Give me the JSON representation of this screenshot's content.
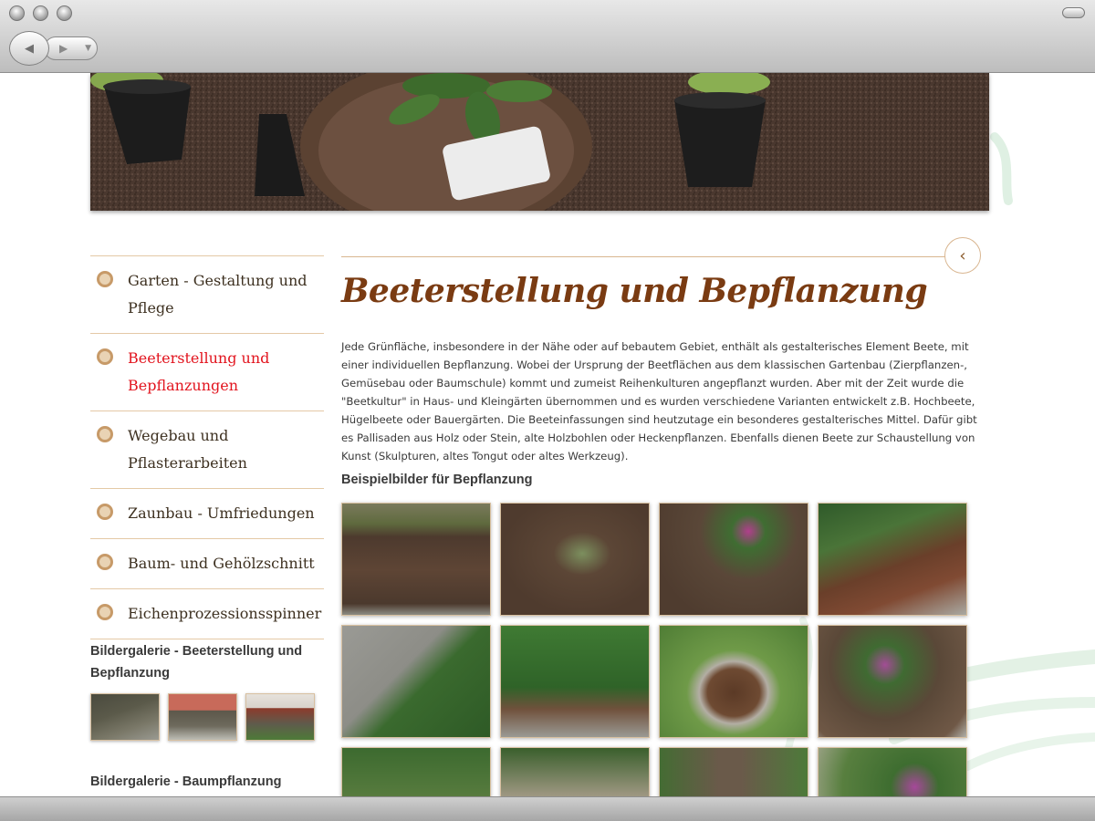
{
  "sidebar": {
    "nav": [
      {
        "label": "Garten - Gestaltung und Pflege",
        "active": false
      },
      {
        "label": "Beeterstellung und Bepflanzungen",
        "active": true
      },
      {
        "label": "Wegebau und Pflasterarbeiten",
        "active": false
      },
      {
        "label": "Zaunbau - Umfriedungen",
        "active": false
      },
      {
        "label": "Baum- und Gehölzschnitt",
        "active": false
      },
      {
        "label": "Eichenprozessionsspinner",
        "active": false
      }
    ],
    "gallery1_title": "Bildergalerie - Beeterstellung und Bepflanzung",
    "gallery2_title": "Bildergalerie - Baumpflanzung"
  },
  "main": {
    "title": "Beeterstellung und Bepflanzung",
    "intro": "Jede Grünfläche, insbesondere in der Nähe oder auf bebautem Gebiet, enthält als gestalterisches Element Beete, mit einer individuellen Bepflanzung. Wobei der Ursprung der Beetflächen aus dem klassischen Gartenbau (Zierpflanzen-, Gemüsebau oder Baumschule) kommt und zumeist Reihenkulturen angepflanzt wurden. Aber mit der Zeit wurde die \"Beetkultur\" in Haus- und Kleingärten übernommen und es wurden verschiedene Varianten entwickelt z.B. Hochbeete, Hügelbeete oder Bauergärten. Die Beeteinfassungen sind heutzutage ein besonderes gestalterisches Mittel. Dafür gibt es Pallisaden aus Holz oder Stein, alte Holzbohlen oder Heckenpflanzen. Ebenfalls dienen Beete zur Schaustellung von Kunst (Skulpturen, altes Tongut oder altes Werkzeug).",
    "section_title": "Beispielbilder für Bepflanzung",
    "back_glyph": "‹"
  },
  "chrome": {
    "back_glyph": "◀",
    "forward_glyph": "▶"
  }
}
